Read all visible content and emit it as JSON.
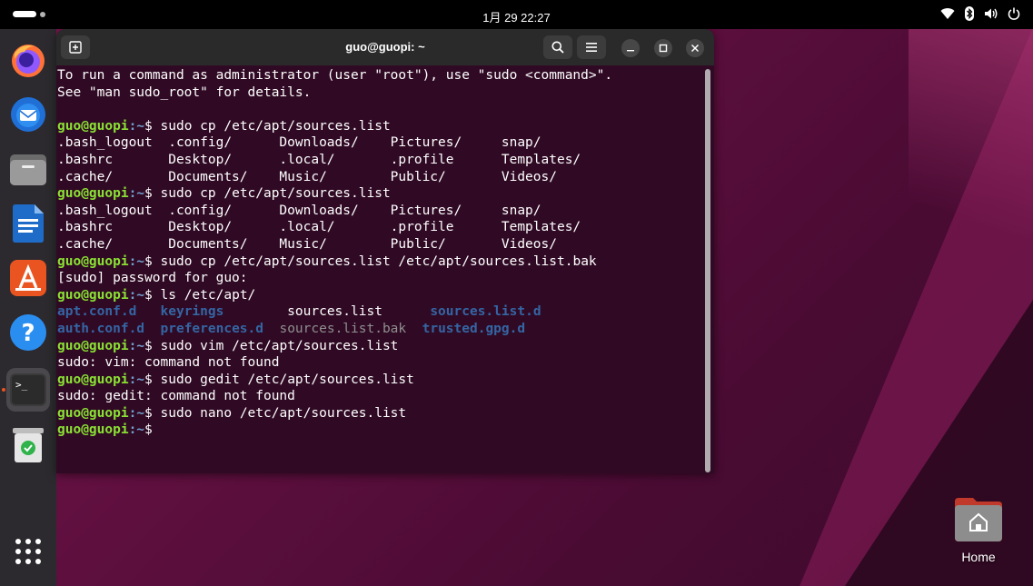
{
  "topbar": {
    "clock": "1月 29  22:27",
    "tray_icons": [
      "wifi-icon",
      "bluetooth-icon",
      "volume-icon",
      "power-icon"
    ]
  },
  "dock": {
    "items": [
      {
        "name": "firefox",
        "icon": "firefox-icon"
      },
      {
        "name": "thunderbird",
        "icon": "thunderbird-icon"
      },
      {
        "name": "files",
        "icon": "files-icon"
      },
      {
        "name": "libreoffice-writer",
        "icon": "writer-icon"
      },
      {
        "name": "app-center",
        "icon": "app-center-icon"
      },
      {
        "name": "help",
        "icon": "help-icon",
        "glyph": "?"
      },
      {
        "name": "terminal",
        "icon": "terminal-icon",
        "glyph": ">_",
        "active": true
      },
      {
        "name": "trash",
        "icon": "trash-icon"
      },
      {
        "name": "show-apps",
        "icon": "grid-icon"
      }
    ]
  },
  "terminal": {
    "title": "guo@guopi: ~",
    "prompt_user": "guo@guopi",
    "prompt_path": ":~",
    "prompt_sign": "$ ",
    "lines": [
      {
        "type": "text",
        "text": "To run a command as administrator (user \"root\"), use \"sudo <command>\"."
      },
      {
        "type": "text",
        "text": "See \"man sudo_root\" for details."
      },
      {
        "type": "text",
        "text": ""
      },
      {
        "type": "prompt",
        "cmd": "sudo cp /etc/apt/sources.list"
      },
      {
        "type": "text",
        "text": ".bash_logout  .config/      Downloads/    Pictures/     snap/"
      },
      {
        "type": "text",
        "text": ".bashrc       Desktop/      .local/       .profile      Templates/"
      },
      {
        "type": "text",
        "text": ".cache/       Documents/    Music/        Public/       Videos/"
      },
      {
        "type": "prompt",
        "cmd": "sudo cp /etc/apt/sources.list"
      },
      {
        "type": "text",
        "text": ".bash_logout  .config/      Downloads/    Pictures/     snap/"
      },
      {
        "type": "text",
        "text": ".bashrc       Desktop/      .local/       .profile      Templates/"
      },
      {
        "type": "text",
        "text": ".cache/       Documents/    Music/        Public/       Videos/"
      },
      {
        "type": "prompt",
        "cmd": "sudo cp /etc/apt/sources.list /etc/apt/sources.list.bak"
      },
      {
        "type": "text",
        "text": "[sudo] password for guo:"
      },
      {
        "type": "prompt",
        "cmd": "ls /etc/apt/"
      },
      {
        "type": "ls",
        "cells": [
          {
            "text": "apt.conf.d   ",
            "cls": "dir"
          },
          {
            "text": "keyrings   ",
            "cls": "dir"
          },
          {
            "text": "     sources.list      ",
            "cls": "plain"
          },
          {
            "text": "sources.list.d",
            "cls": "dir"
          }
        ]
      },
      {
        "type": "ls",
        "cells": [
          {
            "text": "auth.conf.d  ",
            "cls": "dir"
          },
          {
            "text": "preferences.d",
            "cls": "dir"
          },
          {
            "text": "  sources.list.bak  ",
            "cls": "dim"
          },
          {
            "text": "trusted.gpg.d",
            "cls": "dir"
          }
        ]
      },
      {
        "type": "prompt",
        "cmd": "sudo vim /etc/apt/sources.list"
      },
      {
        "type": "text",
        "text": "sudo: vim: command not found"
      },
      {
        "type": "prompt",
        "cmd": "sudo gedit /etc/apt/sources.list"
      },
      {
        "type": "text",
        "text": "sudo: gedit: command not found"
      },
      {
        "type": "prompt",
        "cmd": "sudo nano /etc/apt/sources.list"
      },
      {
        "type": "prompt",
        "cmd": ""
      }
    ]
  },
  "desktop": {
    "home_label": "Home"
  },
  "colors": {
    "terminal_bg": "#300a24",
    "prompt_user": "#8ae234",
    "prompt_path": "#729fcf",
    "directory": "#3465a4",
    "ubuntu_orange": "#e95420"
  }
}
